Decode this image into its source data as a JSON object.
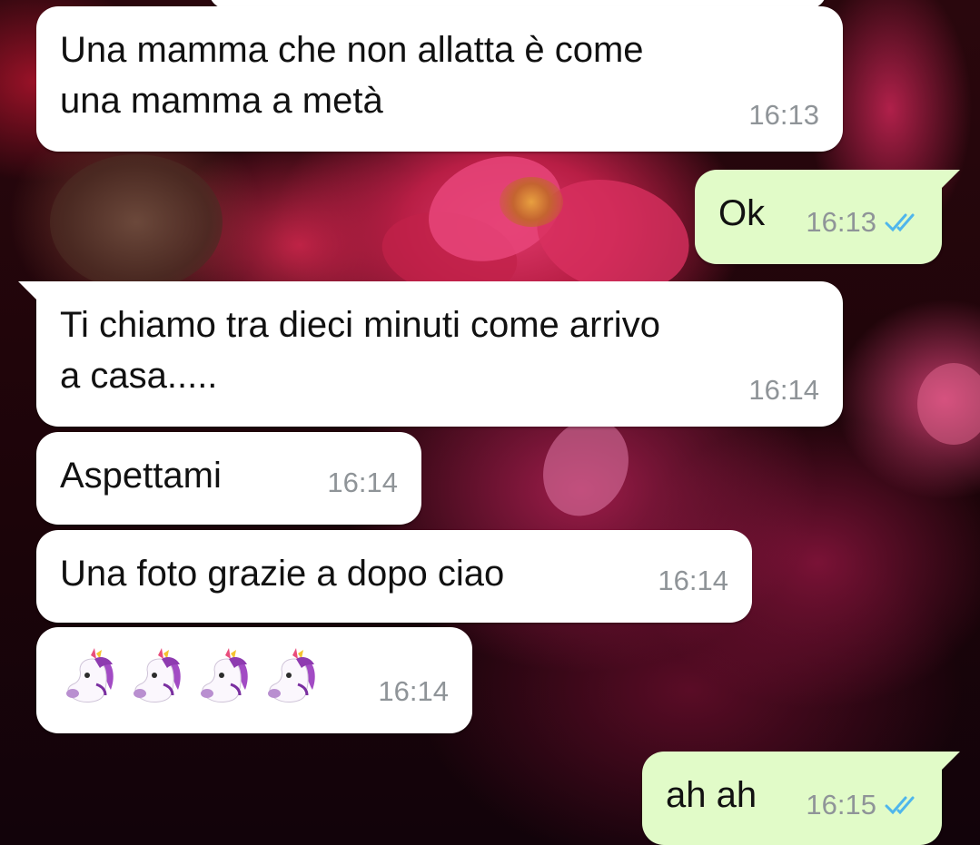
{
  "colors": {
    "incoming_bubble": "#ffffff",
    "outgoing_bubble": "#e1fbc8",
    "timestamp": "#8f9498",
    "read_ticks": "#4fb6ec"
  },
  "messages": [
    {
      "direction": "incoming",
      "lines": [
        "Una mamma che non allatta è come",
        "una mamma a metà"
      ],
      "time": "16:13"
    },
    {
      "direction": "outgoing",
      "lines": [
        "Ok"
      ],
      "time": "16:13",
      "status_icon": "double-check-read-icon"
    },
    {
      "direction": "incoming",
      "lines": [
        "Ti chiamo tra dieci minuti come arrivo",
        "a casa....."
      ],
      "time": "16:14"
    },
    {
      "direction": "incoming",
      "lines": [
        "Aspettami"
      ],
      "time": "16:14"
    },
    {
      "direction": "incoming",
      "lines": [
        "Una foto grazie a dopo ciao"
      ],
      "time": "16:14"
    },
    {
      "direction": "incoming",
      "emoji": [
        "unicorn-icon",
        "unicorn-icon",
        "unicorn-icon",
        "unicorn-icon"
      ],
      "time": "16:14"
    },
    {
      "direction": "outgoing",
      "lines": [
        "ah ah"
      ],
      "time": "16:15",
      "status_icon": "double-check-read-icon"
    }
  ]
}
